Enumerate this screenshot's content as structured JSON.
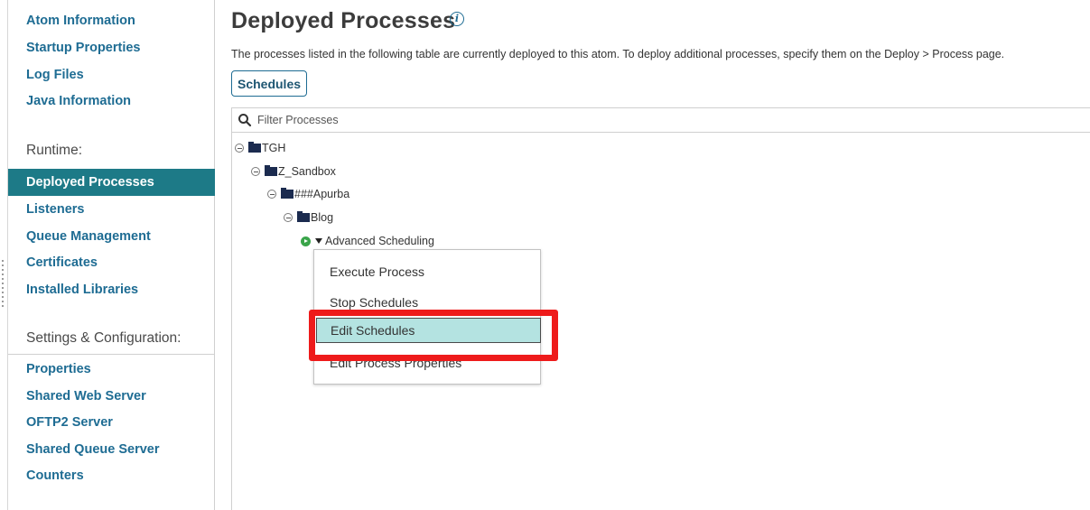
{
  "sidebar": {
    "items_top": [
      {
        "label": "Atom Information"
      },
      {
        "label": "Startup Properties"
      },
      {
        "label": "Log Files"
      },
      {
        "label": "Java Information"
      }
    ],
    "runtime_heading": "Runtime:",
    "runtime_items": [
      {
        "label": "Deployed Processes",
        "active": true
      },
      {
        "label": "Listeners"
      },
      {
        "label": "Queue Management"
      },
      {
        "label": "Certificates"
      },
      {
        "label": "Installed Libraries"
      }
    ],
    "settings_heading": "Settings & Configuration:",
    "settings_items": [
      {
        "label": "Properties"
      },
      {
        "label": "Shared Web Server"
      },
      {
        "label": "OFTP2 Server"
      },
      {
        "label": "Shared Queue Server"
      },
      {
        "label": "Counters"
      }
    ]
  },
  "main": {
    "title": "Deployed Processes",
    "info_icon": "info-icon",
    "description": "The processes listed in the following table are currently deployed to this atom. To deploy additional processes, specify them on the Deploy > Process page.",
    "schedules_button": "Schedules",
    "filter_placeholder": "Filter Processes"
  },
  "tree": [
    {
      "label": "TGH",
      "type": "folder"
    },
    {
      "label": "Z_Sandbox",
      "type": "folder"
    },
    {
      "label": "###Apurba",
      "type": "folder"
    },
    {
      "label": "Blog",
      "type": "folder"
    },
    {
      "label": "Advanced Scheduling",
      "type": "process",
      "status": "running"
    }
  ],
  "context_menu": {
    "items": [
      {
        "label": "Execute Process"
      },
      {
        "label": "Stop Schedules"
      },
      {
        "label": "Edit Schedules",
        "highlighted": true
      },
      {
        "label": "Edit Process Properties"
      }
    ]
  },
  "colors": {
    "link": "#1e6c93",
    "active_nav": "#1d7a87",
    "menu_highlight": "#b4e3e1",
    "annotation_red": "#ee1b1b",
    "folder": "#1b2b4f",
    "running": "#3aa54a"
  }
}
